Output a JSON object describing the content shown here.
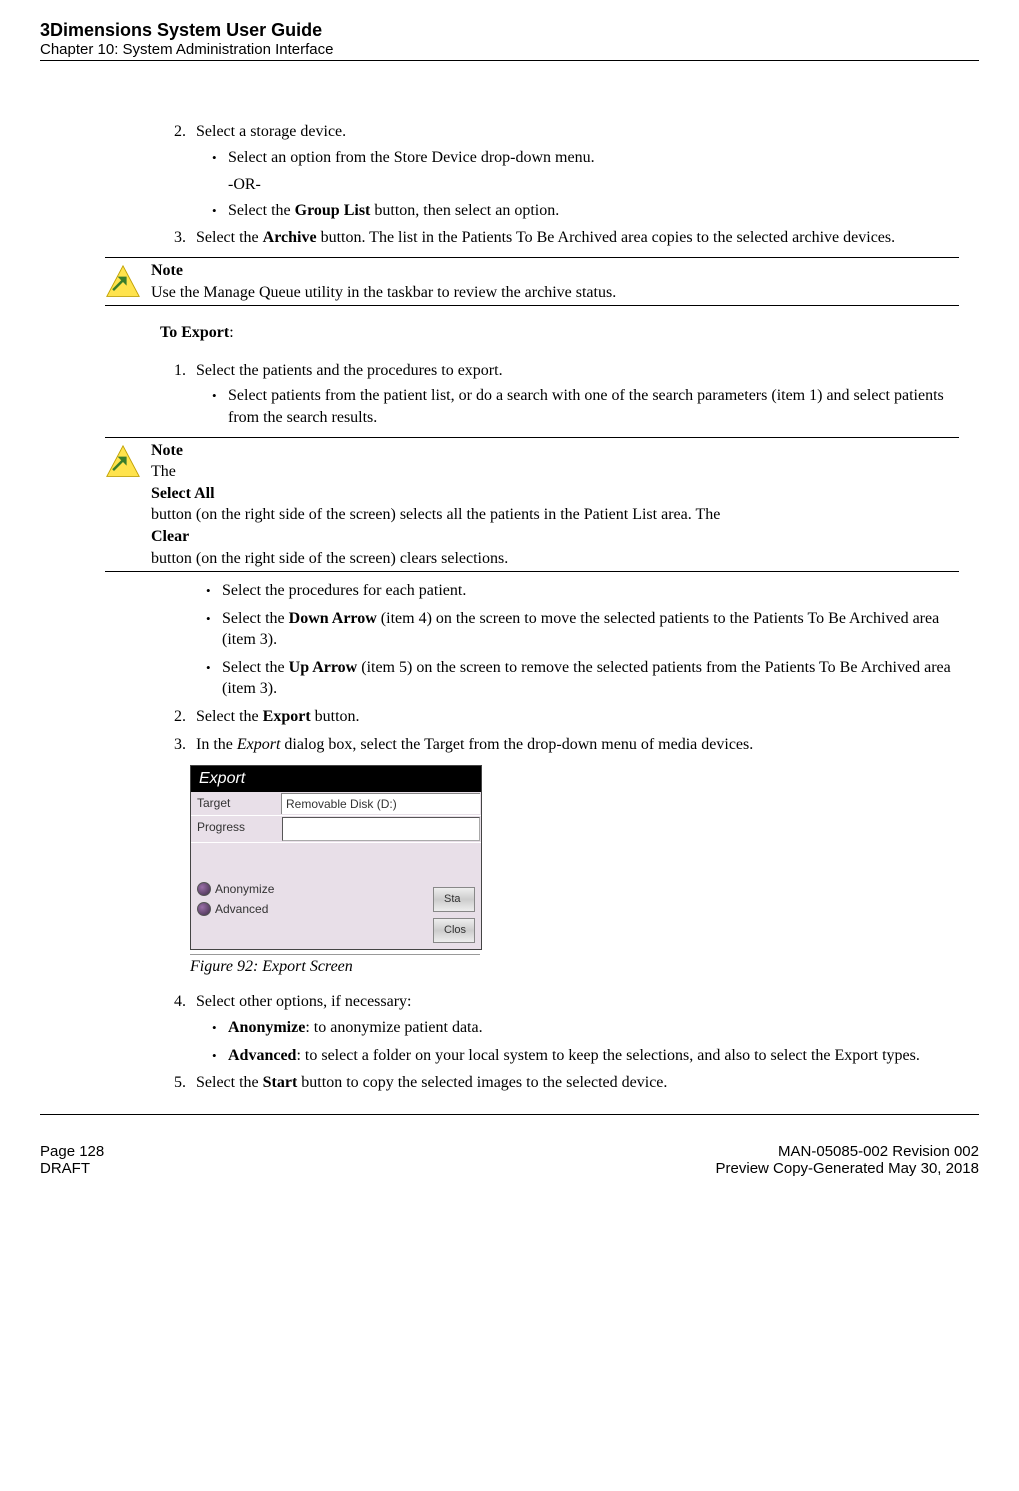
{
  "header": {
    "title": "3Dimensions System User Guide",
    "chapter": "Chapter 10: System Administration Interface"
  },
  "body": {
    "step2": "Select a storage device.",
    "step2_b1": "Select an option from the Store Device drop-down menu.",
    "or": "-OR-",
    "step2_b2_pre": "Select the ",
    "step2_b2_bold": "Group List",
    "step2_b2_post": " button, then select an option.",
    "step3_pre": "Select the ",
    "step3_bold": "Archive",
    "step3_post": " button. The list in the Patients To Be Archived area copies to the selected archive devices.",
    "note1_title": "Note",
    "note1_text": "Use the Manage Queue utility in the taskbar to review the archive status.",
    "to_export": "To Export",
    "exp1": "Select the patients and the procedures to export.",
    "exp1_b1": "Select patients from the patient list, or do a search with one of the search parameters (item 1) and select patients from the search results.",
    "note2_title": "Note",
    "note2_pre": "The ",
    "note2_b1": "Select All",
    "note2_mid": " button (on the right side of the screen) selects all the patients in the Patient List area. The ",
    "note2_b2": "Clear",
    "note2_post": " button (on the right side of the screen) clears selections.",
    "exp1_b2": "Select the procedures for each patient.",
    "exp1_b3_pre": "Select the ",
    "exp1_b3_bold": "Down Arrow",
    "exp1_b3_post": " (item 4) on the screen to move the selected patients to the Patients To Be Archived area (item 3).",
    "exp1_b4_pre": "Select the ",
    "exp1_b4_bold": "Up Arrow",
    "exp1_b4_post": " (item 5) on the screen to remove the selected patients from the Patients To Be Archived area (item 3).",
    "exp2_pre": "Select the ",
    "exp2_bold": "Export",
    "exp2_post": " button.",
    "exp3_pre": "In the ",
    "exp3_ital": "Export",
    "exp3_post": " dialog box, select the Target from the drop-down menu of media devices.",
    "figure": {
      "title": "Export",
      "target_label": "Target",
      "target_value": "Removable Disk (D:)",
      "progress_label": "Progress",
      "radio1": "Anonymize",
      "radio2": "Advanced",
      "btn1": "Sta",
      "btn2": "Clos",
      "caption": "Figure 92: Export Screen"
    },
    "exp4": "Select other options, if necessary:",
    "exp4_b1_bold": "Anonymize",
    "exp4_b1_post": ": to anonymize patient data.",
    "exp4_b2_bold": "Advanced",
    "exp4_b2_post": ": to select a folder on your local system to keep the selections, and also to select the Export types.",
    "exp5_pre": "Select the ",
    "exp5_bold": "Start",
    "exp5_post": " button to copy the selected images to the selected device."
  },
  "footer": {
    "page": "Page 128",
    "draft": "DRAFT",
    "doc": "MAN-05085-002 Revision 002",
    "date": "Preview Copy-Generated May 30, 2018"
  }
}
